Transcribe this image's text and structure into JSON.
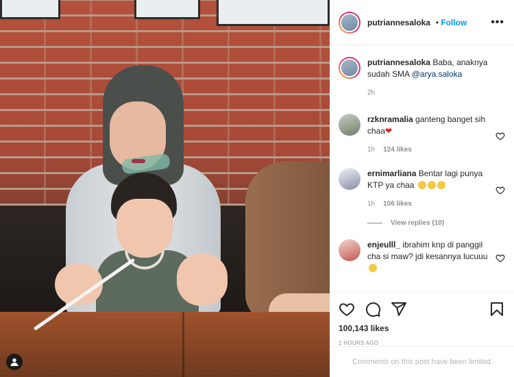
{
  "post": {
    "username": "putriannesaloka",
    "follow_label": "Follow",
    "dot": "•",
    "more": "•••",
    "caption_text": "Baba, anaknya sudah SMA",
    "caption_mention": "@arya.saloka",
    "caption_time": "2h"
  },
  "comments": [
    {
      "user": "rzknramalia",
      "text": "ganteng banget sih chaa",
      "time": "1h",
      "likes": "124 likes"
    },
    {
      "user": "ernimarliana",
      "text": "Bentar lagi punya KTP ya chaa",
      "time": "1h",
      "likes": "106 likes",
      "view_replies": "View replies (10)"
    },
    {
      "user": "enjeulll_",
      "text": "ibrahim knp di panggil cha si maw? jdi kesannya lucuuu"
    }
  ],
  "footer": {
    "likes": "100,143 likes",
    "time": "2 HOURS AGO",
    "limited": "Comments on this post have been limited."
  },
  "colors": {
    "accent": "#0095f6",
    "muted": "#8e8e8e",
    "heart": "#ed1c24"
  }
}
